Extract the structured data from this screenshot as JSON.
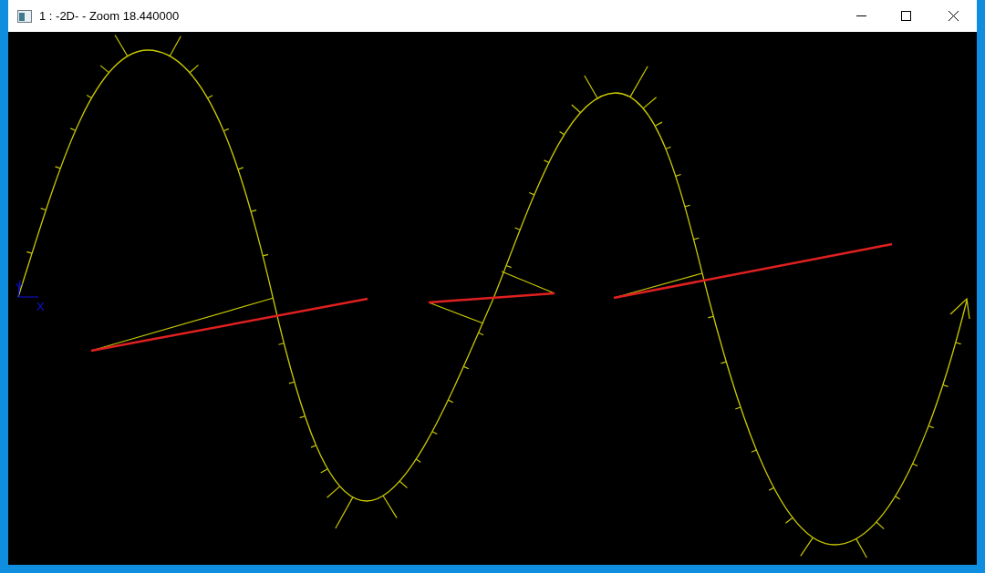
{
  "window": {
    "title": "1 : -2D- - Zoom 18.440000"
  },
  "viewport": {
    "axis_labels": [
      "Y",
      "X"
    ]
  }
}
